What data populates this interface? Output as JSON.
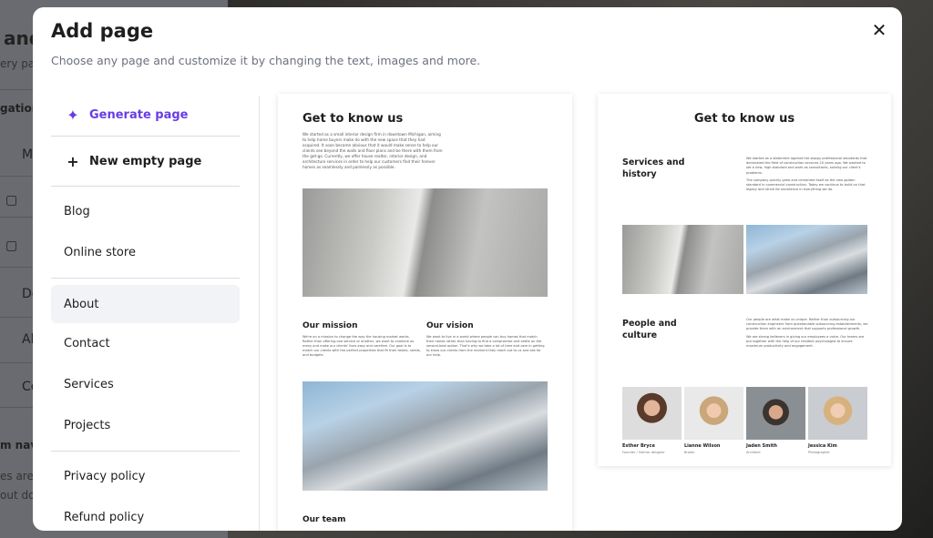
{
  "background": {
    "heading": "and",
    "sub": "ery pa",
    "section1": "gation",
    "items": [
      "Mi",
      "Do",
      "Ab",
      "Co"
    ],
    "section2": "m nav",
    "text1": "es are",
    "text2": "out do"
  },
  "modal": {
    "title": "Add page",
    "subtitle": "Choose any page and customize it by changing the text, images and more.",
    "close_icon": "close-icon"
  },
  "sidebar": {
    "generate": "Generate page",
    "new_empty": "New empty page",
    "items": [
      "Blog",
      "Online store",
      "About",
      "Contact",
      "Services",
      "Projects",
      "Privacy policy",
      "Refund policy"
    ],
    "selected": "About"
  },
  "accent": "#673de6",
  "preview1": {
    "title": "Get to know us",
    "intro": "We started as a small interior design firm in downtown Michigan, aiming to help home buyers make do with the new space that they had acquired. It soon became obvious that it would make sense to help our clients see beyond the walls and floor plans and be there with them from the get-go. Currently, we offer house realtor, interior design, and architecture services in order to help our customers find their forever homes as seamlessly and painlessly as possible.",
    "mission_title": "Our mission",
    "mission_text": "We're on a mission to change the way the housing market works. Rather than offering one service or another, we want to combine as many and make our clients' lives easy and carefree. Our goal is to match our clients with the perfect properties that fit their tastes, needs, and budgets.",
    "vision_title": "Our vision",
    "vision_text": "We want to live in a world where people can buy homes that match their needs rather than having to find a compromise and settle on the second-best option. That's why we take a lot of time and care in getting to know our clients from the moment they reach out to us and ask for our help.",
    "team_title": "Our team"
  },
  "preview2": {
    "title": "Get to know us",
    "services_title": "Services and history",
    "services_p1": "We started as a statement against the sloppy professional standards that dominated the field of construction services 20 years ago. We wanted to set a new, high standard and work as consultants, solving our client's problems.",
    "services_p2": "The company quickly grew and cemented itself as the new golden standard in commercial construction. Today we continue to build on that legacy and strive for excellence in everything we do.",
    "people_title": "People and culture",
    "people_p1": "Our people are what make us unique. Rather than outsourcing our construction engineers from questionable outsourcing establishments, we provide them with an environment that supports professional growth.",
    "people_p2": "We are strong believers in giving our employees a voice. Our teams are put together with the help of our resident psychologist to ensure maximum productivity and engagement.",
    "team": [
      {
        "name": "Esther Bryce",
        "role": "Founder / Interior designer"
      },
      {
        "name": "Lianne Wilson",
        "role": "Broker"
      },
      {
        "name": "Jaden Smith",
        "role": "Architect"
      },
      {
        "name": "Jessica Kim",
        "role": "Photographer"
      }
    ]
  }
}
